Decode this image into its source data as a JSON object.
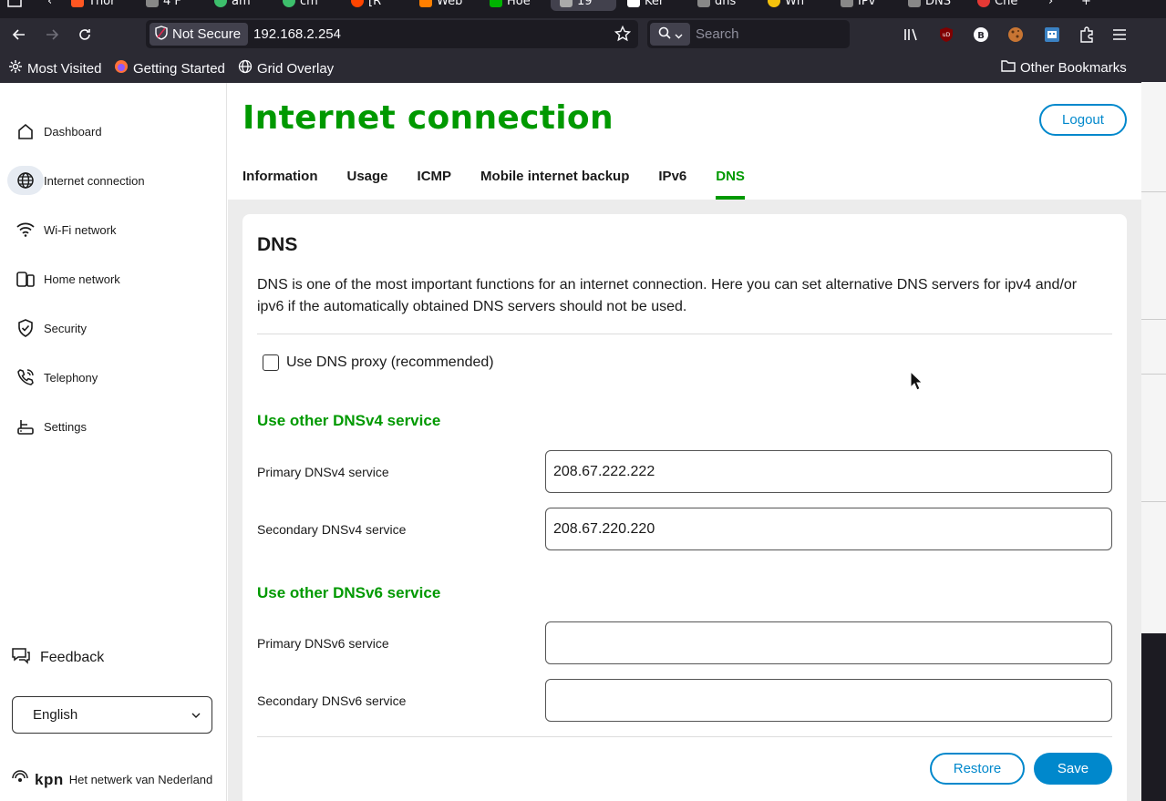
{
  "browser": {
    "tabs": [
      {
        "label": "Thor",
        "color": "#ff5722"
      },
      {
        "label": "4 F",
        "color": "#888888"
      },
      {
        "label": "am",
        "color": "#3dbf6c"
      },
      {
        "label": "cm",
        "color": "#3dbf6c"
      },
      {
        "label": "[R",
        "color": "#ff4500"
      },
      {
        "label": "Web",
        "color": "#ff7f00"
      },
      {
        "label": "Hoe",
        "color": "#00b300"
      },
      {
        "label": "19",
        "color": "#aaaaaa"
      },
      {
        "label": "Ker",
        "color": "#ffffff"
      },
      {
        "label": "dns",
        "color": "#888888"
      },
      {
        "label": "Wh",
        "color": "#f4c20d"
      },
      {
        "label": "IPv",
        "color": "#888888"
      },
      {
        "label": "DNS",
        "color": "#888888"
      },
      {
        "label": "Che",
        "color": "#e53935"
      }
    ],
    "not_secure_label": "Not Secure",
    "url": "192.168.2.254",
    "search_placeholder": "Search",
    "bookmarks": {
      "most_visited": "Most Visited",
      "getting_started": "Getting Started",
      "grid_overlay": "Grid Overlay",
      "other": "Other Bookmarks"
    }
  },
  "sidebar": {
    "items": [
      {
        "label": "Dashboard",
        "icon": "home-icon"
      },
      {
        "label": "Internet connection",
        "icon": "globe-icon"
      },
      {
        "label": "Wi-Fi network",
        "icon": "wifi-icon"
      },
      {
        "label": "Home network",
        "icon": "devices-icon"
      },
      {
        "label": "Security",
        "icon": "shield-icon"
      },
      {
        "label": "Telephony",
        "icon": "phone-icon"
      },
      {
        "label": "Settings",
        "icon": "router-icon"
      }
    ],
    "feedback": "Feedback",
    "language": "English",
    "kpn_logo": "kpn",
    "kpn_tagline": "Het netwerk van Nederland"
  },
  "header": {
    "title": "Internet connection",
    "logout": "Logout",
    "tabs": [
      "Information",
      "Usage",
      "ICMP",
      "Mobile internet backup",
      "IPv6",
      "DNS"
    ],
    "active_tab": "DNS"
  },
  "dns": {
    "heading": "DNS",
    "description": "DNS is one of the most important functions for an internet connection. Here you can set alternative DNS servers for ipv4 and/or ipv6 if the automatically obtained DNS servers should not be used.",
    "proxy_label": "Use DNS proxy (recommended)",
    "proxy_checked": false,
    "v4_heading": "Use other DNSv4 service",
    "primary_v4_label": "Primary DNSv4 service",
    "primary_v4_value": "208.67.222.222",
    "secondary_v4_label": "Secondary DNSv4 service",
    "secondary_v4_value": "208.67.220.220",
    "v6_heading": "Use other DNSv6 service",
    "primary_v6_label": "Primary DNSv6 service",
    "primary_v6_value": "",
    "secondary_v6_label": "Secondary DNSv6 service",
    "secondary_v6_value": "",
    "restore": "Restore",
    "save": "Save"
  },
  "colors": {
    "accent_green": "#009900",
    "accent_blue": "#0088cc"
  }
}
